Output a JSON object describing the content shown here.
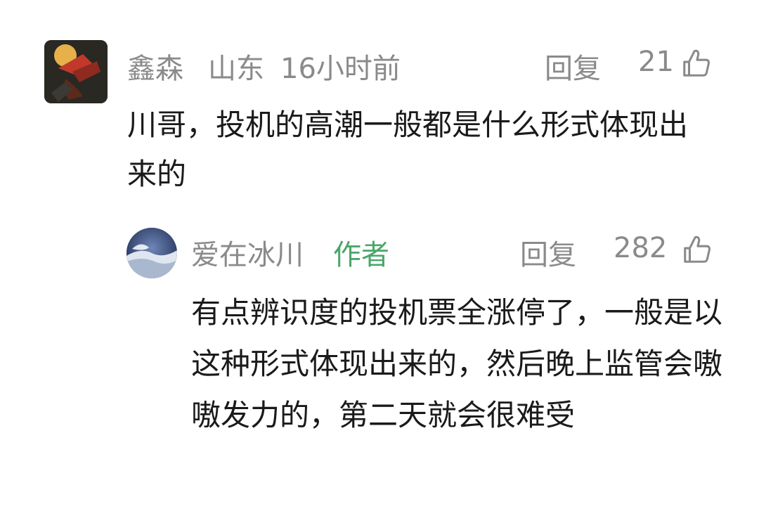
{
  "comment": {
    "username": "鑫森",
    "location": "山东",
    "time": "16小时前",
    "reply_label": "回复",
    "like_count": "21",
    "text": "川哥，投机的高潮一般都是什么形式体现出来的"
  },
  "reply": {
    "username": "爱在冰川",
    "author_badge": "作者",
    "reply_label": "回复",
    "like_count": "282",
    "text": "有点辨识度的投机票全涨停了，一般是以这种形式体现出来的，然后晚上监管会嗷嗷发力的，第二天就会很难受"
  },
  "colors": {
    "meta_gray": "#8a8a8a",
    "author_green": "#4aa66a",
    "body_text": "#1a1a1a"
  },
  "icons": {
    "like": "thumbs-up-icon"
  }
}
